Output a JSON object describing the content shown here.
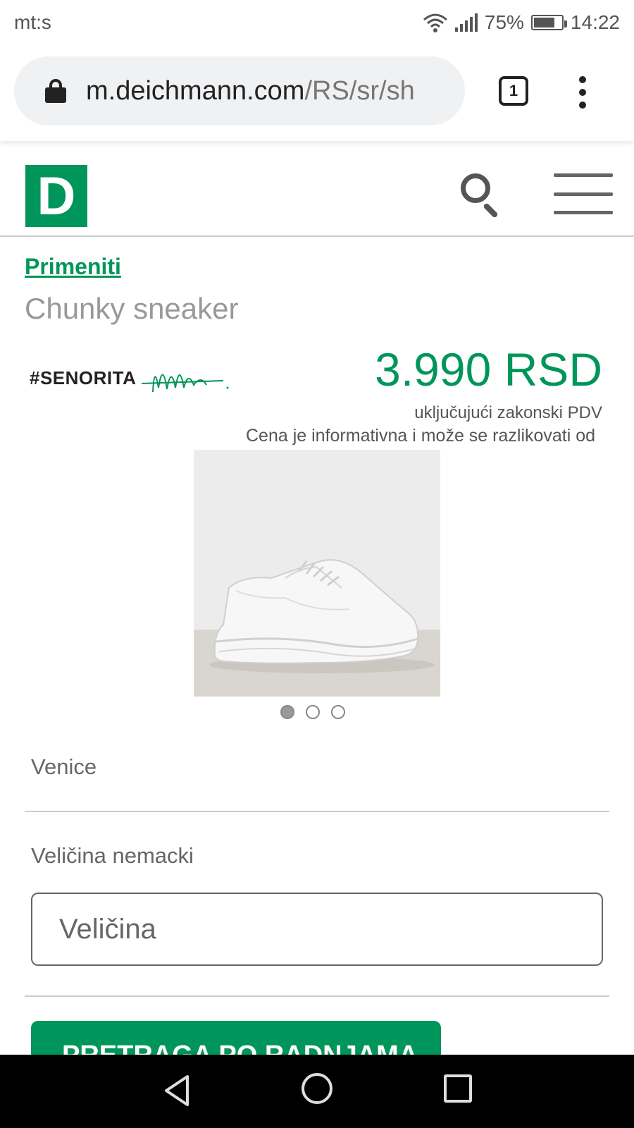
{
  "statusbar": {
    "carrier": "mt:s",
    "battery": "75%",
    "time": "14:22"
  },
  "browser": {
    "url_domain": "m.deichmann.com",
    "url_path": "/RS/sr/sh",
    "tab_count": "1"
  },
  "site": {
    "logo_letter": "D"
  },
  "product": {
    "breadcrumb": "Primeniti",
    "title": "Chunky sneaker",
    "brand_text": "#SENORITA",
    "price": "3.990 RSD",
    "vat_note": "uključujući zakonski PDV",
    "info_note": "Cena je informativna i može se razlikovati od",
    "image_count": 3,
    "active_image": 1,
    "color_label": "Venice",
    "size_label": "Veličina nemacki",
    "size_placeholder": "Veličina",
    "cta_label": "PRETRAGA PO RADNJAMA"
  },
  "colors": {
    "brand_green": "#00955a"
  }
}
